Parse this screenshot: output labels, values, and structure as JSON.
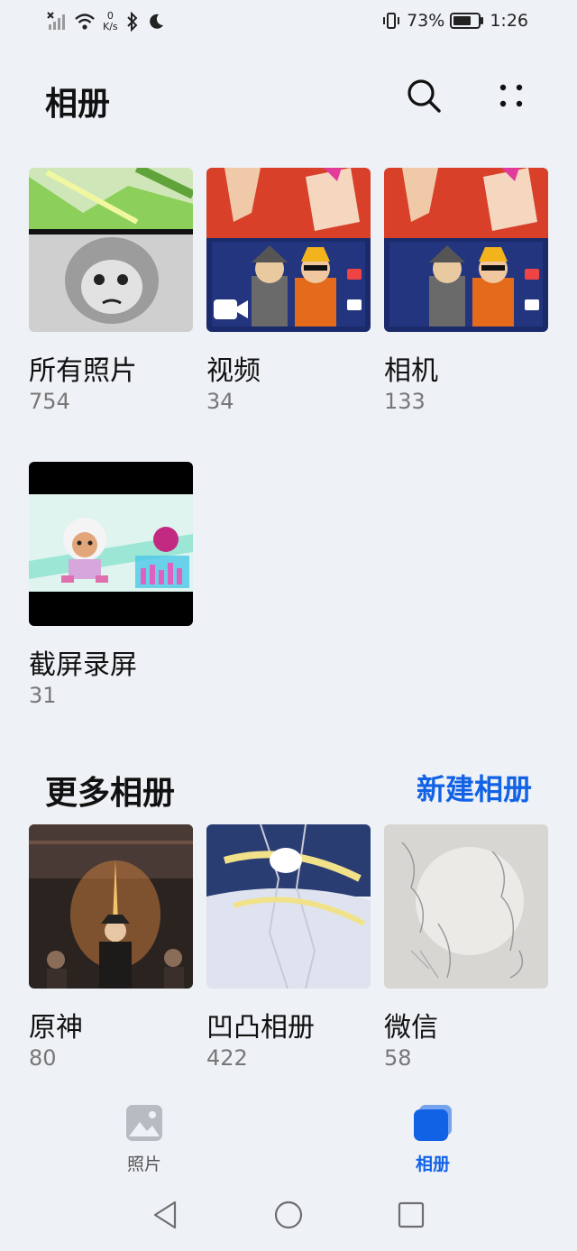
{
  "status_bar": {
    "network_speed": "0",
    "network_unit": "K/s",
    "battery_percent": 73,
    "battery_text": "73%",
    "time": "1:26",
    "left_icons": [
      "signal-off-icon",
      "wifi-icon",
      "bluetooth-icon",
      "moon-icon"
    ],
    "right_icons": [
      "vibrate-icon",
      "battery-icon"
    ]
  },
  "header": {
    "title": "相册",
    "search_icon": "search-icon",
    "more_icon": "more-icon"
  },
  "albums": [
    {
      "name": "所有照片",
      "count": "754"
    },
    {
      "name": "视频",
      "count": "34",
      "badge_icon": "video-camera-icon"
    },
    {
      "name": "相机",
      "count": "133"
    },
    {
      "name": "截屏录屏",
      "count": "31"
    }
  ],
  "more_albums": {
    "title": "更多相册",
    "new_album_label": "新建相册",
    "items": [
      {
        "name": "原神",
        "count": "80"
      },
      {
        "name": "凹凸相册",
        "count": "422"
      },
      {
        "name": "微信",
        "count": "58"
      }
    ]
  },
  "bottom_nav": {
    "items": [
      {
        "label": "照片",
        "icon": "photo-icon",
        "active": false
      },
      {
        "label": "相册",
        "icon": "album-icon",
        "active": true
      }
    ]
  },
  "colors": {
    "accent": "#1262e6",
    "background": "#eef1f5",
    "inactive": "#777777"
  },
  "system_nav": [
    "back-icon",
    "home-icon",
    "recents-icon"
  ]
}
